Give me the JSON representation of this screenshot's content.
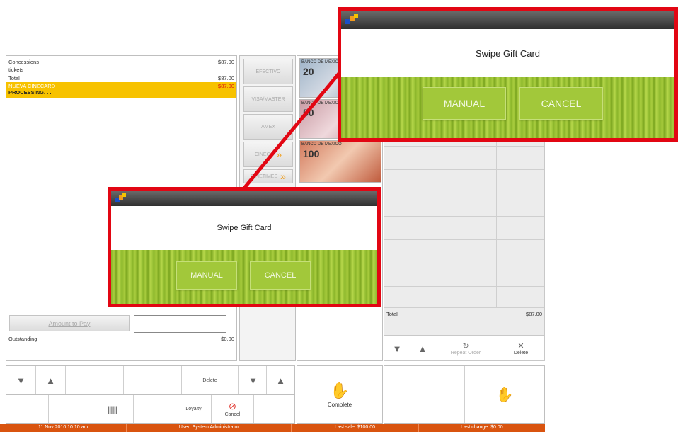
{
  "order": {
    "rows": [
      {
        "label": "Concessions",
        "value": "$87.00"
      },
      {
        "label": "tickets",
        "value": ""
      },
      {
        "label": "Total",
        "value": "$87.00"
      }
    ],
    "highlight": {
      "label": "NUEVA CINECARD",
      "value": "$87.00",
      "status": "PROCESSING. . ."
    },
    "amount_to_pay_label": "Amount to Pay",
    "outstanding_label": "Outstanding",
    "outstanding_value": "$0.00"
  },
  "payment_methods": [
    "EFECTIVO",
    "VISA/MASTER",
    "AMEX",
    "CINECA",
    "CINETIMES"
  ],
  "banknotes": [
    {
      "bank": "BANCO DE MEXICO",
      "value": "20"
    },
    {
      "bank": "BANCO DE MEXICO",
      "value": "50"
    },
    {
      "bank": "BANCO DE MEXICO",
      "value": "100"
    }
  ],
  "right_panel": {
    "total_label": "Total",
    "total_value": "$87.00",
    "repeat_order_label": "Repeat Order",
    "delete_label": "Delete"
  },
  "bottom_toolbar": {
    "delete_label": "Delete",
    "loyalty_label": "Loyalty",
    "cancel_label": "Cancel",
    "complete_label": "Complete"
  },
  "dialog": {
    "message": "Swipe Gift Card",
    "manual_label": "MANUAL",
    "cancel_label": "CANCEL"
  },
  "status_bar": {
    "datetime": "11 Nov 2010 10:10 am",
    "user": "User:  System  Administrator",
    "last_sale": "Last sale:  $100.00",
    "last_change": "Last change:  $0.00"
  },
  "colors": {
    "highlight": "#f7c200",
    "status_bar": "#d9540f",
    "callout_border": "#e20613",
    "button_green": "#a2c83a"
  }
}
